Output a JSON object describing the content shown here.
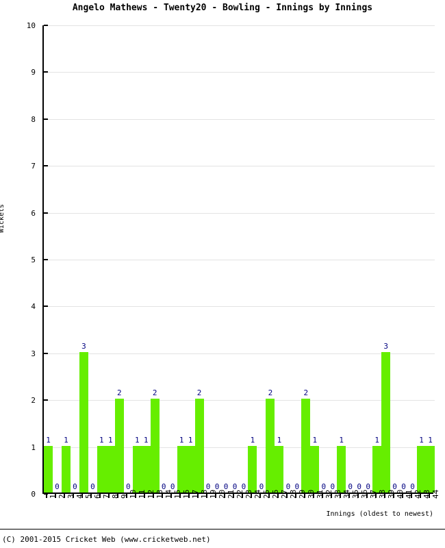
{
  "chart_data": {
    "type": "bar",
    "title": "Angelo Mathews - Twenty20 - Bowling - Innings by Innings",
    "xlabel": "Innings (oldest to newest)",
    "ylabel": "Wickets",
    "ylim": [
      0,
      10
    ],
    "ytick_labels": [
      "0",
      "1",
      "2",
      "3",
      "4",
      "5",
      "6",
      "7",
      "8",
      "9",
      "10"
    ],
    "ytick_values": [
      0,
      1,
      2,
      3,
      4,
      5,
      6,
      7,
      8,
      9,
      10
    ],
    "grid": true,
    "legend": "none",
    "bar_color": "#66ee00",
    "value_label_color": "#000080",
    "gridline_color": "#e3e3e3",
    "axis_color": "#000000",
    "categories": [
      "1",
      "2",
      "3",
      "4",
      "5",
      "6",
      "7",
      "8",
      "9",
      "10",
      "11",
      "12",
      "13",
      "14",
      "15",
      "16",
      "17",
      "18",
      "19",
      "20",
      "21",
      "22",
      "23",
      "24",
      "25",
      "26",
      "27",
      "28",
      "29",
      "30",
      "31",
      "32",
      "33",
      "34",
      "35",
      "36",
      "37",
      "38",
      "39",
      "40",
      "41",
      "42",
      "43",
      "44"
    ],
    "values": [
      1,
      0,
      1,
      0,
      3,
      0,
      1,
      1,
      2,
      0,
      1,
      1,
      2,
      0,
      0,
      1,
      1,
      2,
      0,
      0,
      0,
      0,
      0,
      1,
      0,
      2,
      1,
      0,
      0,
      2,
      1,
      0,
      0,
      1,
      0,
      0,
      0,
      1,
      3,
      0,
      0,
      0,
      1,
      1
    ],
    "data_labels": [
      "1",
      "0",
      "1",
      "0",
      "3",
      "0",
      "1",
      "1",
      "2",
      "0",
      "1",
      "1",
      "2",
      "0",
      "0",
      "1",
      "1",
      "2",
      "0",
      "0",
      "0",
      "0",
      "0",
      "1",
      "0",
      "2",
      "1",
      "0",
      "0",
      "2",
      "1",
      "0",
      "0",
      "1",
      "0",
      "0",
      "0",
      "1",
      "3",
      "0",
      "0",
      "0",
      "1",
      "1"
    ]
  },
  "footer": {
    "copyright": "(C) 2001-2015 Cricket Web (www.cricketweb.net)"
  }
}
